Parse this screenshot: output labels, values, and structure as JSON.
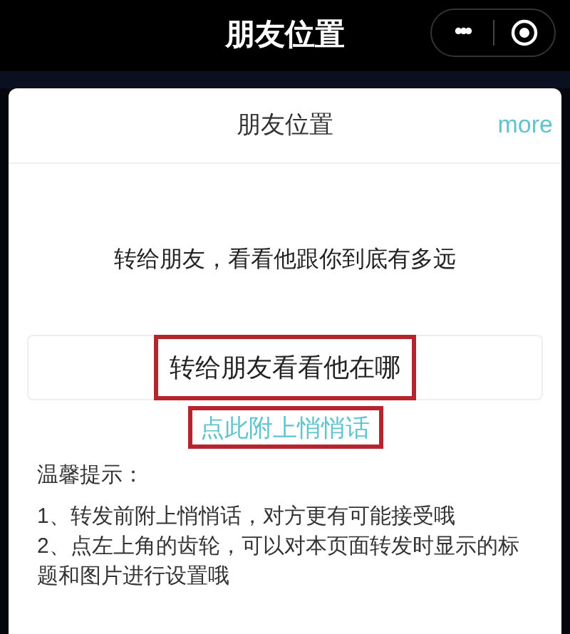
{
  "nav_bar": {
    "title": "朋友位置",
    "menu_glyph": "•••"
  },
  "header": {
    "title": "朋友位置",
    "more": "more"
  },
  "intro": "转给朋友，看看他跟你到底有多远",
  "share_button": {
    "label": "转给朋友看看他在哪",
    "highlighted": true
  },
  "note_link": {
    "label": "点此附上悄悄话",
    "highlighted": true
  },
  "tips": {
    "title": "温馨提示：",
    "items": [
      "1、转发前附上悄悄话，对方更有可能接受哦",
      "2、点左上角的齿轮，可以对本页面转发时显示的标题和图片进行设置哦"
    ]
  }
}
